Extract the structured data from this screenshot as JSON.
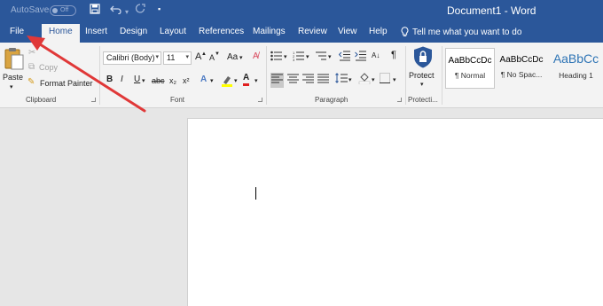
{
  "titlebar": {
    "autosave_label": "AutoSave",
    "autosave_state": "Off",
    "document_title": "Document1  -  Word",
    "color": "#2b579a"
  },
  "tabs": [
    {
      "label": "File"
    },
    {
      "label": "Home",
      "active": true
    },
    {
      "label": "Insert"
    },
    {
      "label": "Design"
    },
    {
      "label": "Layout"
    },
    {
      "label": "References"
    },
    {
      "label": "Mailings"
    },
    {
      "label": "Review"
    },
    {
      "label": "View"
    },
    {
      "label": "Help"
    }
  ],
  "tell_me": "Tell me what you want to do",
  "clipboard": {
    "paste": "Paste",
    "copy": "Copy",
    "format_painter": "Format Painter",
    "group_label": "Clipboard"
  },
  "font": {
    "font_name": "Calibri (Body)",
    "font_size": "11",
    "change_case": "Aa",
    "group_label": "Font"
  },
  "paragraph": {
    "group_label": "Paragraph"
  },
  "protect": {
    "label": "Protect",
    "group_label": "Protecti..."
  },
  "styles": [
    {
      "sample": "AaBbCcDc",
      "name": "¶ Normal"
    },
    {
      "sample": "AaBbCcDc",
      "name": "¶ No Spac..."
    },
    {
      "sample": "AaBbCc",
      "name": "Heading 1"
    }
  ],
  "icons": {
    "save": "save-icon",
    "undo": "undo-icon",
    "redo": "redo-icon",
    "bold": "B",
    "italic": "I",
    "underline": "U",
    "strikethrough": "abc",
    "subscript": "x₂",
    "superscript": "x²",
    "grow_font": "A",
    "shrink_font": "A",
    "pilcrow": "¶"
  },
  "annotation": {
    "type": "red-arrow",
    "points_to": "File",
    "color": "#e03838"
  }
}
